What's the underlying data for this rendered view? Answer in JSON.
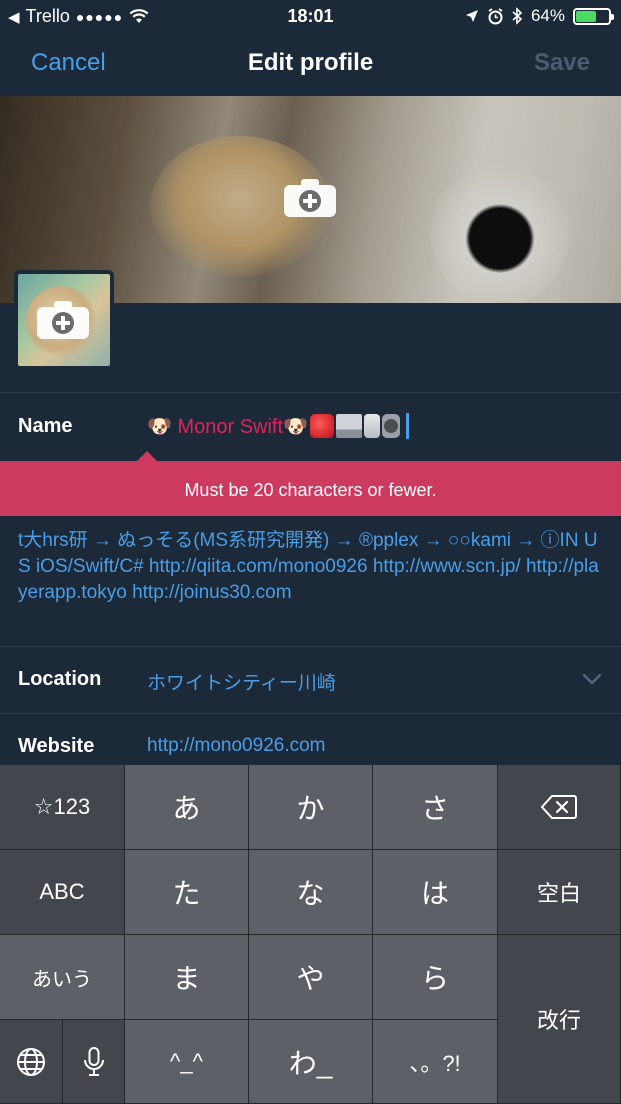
{
  "status_bar": {
    "back_app": "Trello",
    "signal": "●●●●●",
    "time": "18:01",
    "battery_percent": "64%",
    "battery_level": 0.64
  },
  "nav": {
    "cancel": "Cancel",
    "title": "Edit profile",
    "save": "Save"
  },
  "profile": {
    "name_label": "Name",
    "name_text": "🐶 Monor Swift🐶",
    "name_trailing_emoji": [
      "apple-emoji",
      "laptop-emoji",
      "phone-emoji",
      "watch-emoji"
    ],
    "error_message": "Must be 20 characters or fewer.",
    "bio": "t大hrs研 → ぬっそる(MS系研究開発) → ®pplex → ○○kami → ⓘIN US iOS/Swift/C# http://qiita.com/mono0926 http://www.scn.jp/ http://playerapp.tokyo http://joinus30.com",
    "location_label": "Location",
    "location_value": "ホワイトシティー川崎",
    "website_label": "Website",
    "website_value": "http://mono0926.com"
  },
  "keyboard": {
    "keys": {
      "num": "☆123",
      "a": "あ",
      "ka": "か",
      "sa": "さ",
      "abc": "ABC",
      "ta": "た",
      "na": "な",
      "ha": "は",
      "space": "空白",
      "aiu": "あいう",
      "ma": "ま",
      "ya": "や",
      "ra": "ら",
      "enter": "改行",
      "kaomoji": "^_^",
      "wa": "わ_",
      "punct": "、。?!"
    }
  },
  "colors": {
    "background": "#1c2938",
    "accent": "#4a9ee7",
    "error": "#cc3a60",
    "name_text": "#e0245e"
  }
}
